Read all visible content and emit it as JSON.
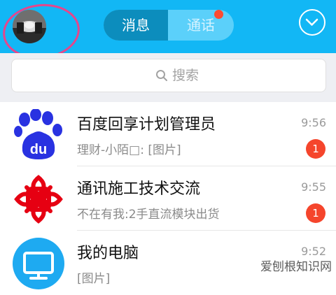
{
  "header": {
    "tabs": [
      {
        "label": "消息",
        "active": true
      },
      {
        "label": "通话",
        "active": false,
        "has_dot": true
      }
    ]
  },
  "search": {
    "placeholder": "搜索"
  },
  "conversations": [
    {
      "title": "百度回享计划管理员",
      "preview": "理财-小陌□: [图片]",
      "time": "9:56",
      "unread": "1",
      "icon": "baidu-paw-icon"
    },
    {
      "title": "通讯施工技术交流",
      "preview": "不在有我:2手直流模块出货",
      "time": "9:55",
      "unread": "1",
      "icon": "unicom-knot-icon"
    },
    {
      "title": "我的电脑",
      "preview": "[图片]",
      "time": "9:52",
      "icon": "monitor-icon"
    }
  ],
  "watermark": "爱刨根知识网",
  "colors": {
    "header_bg": "#12b7f5",
    "active_tab": "#0c8dbd",
    "badge": "#f5452c",
    "annotation_ring": "#e6468b"
  }
}
